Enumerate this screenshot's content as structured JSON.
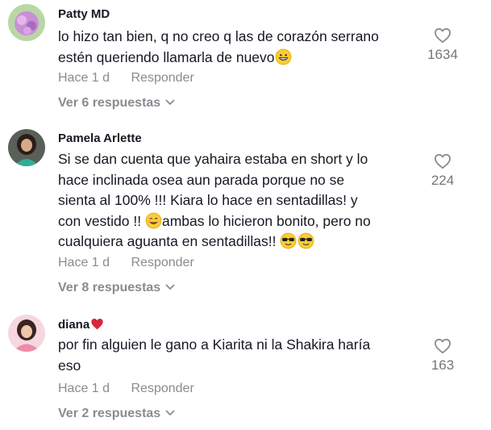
{
  "comments": [
    {
      "username": "Patty MD",
      "text_lines": [
        "lo hizo tan bien, q no creo q las de corazón serrano",
        "estén queriendo llamarla de nuevo"
      ],
      "time": "Hace 1 d",
      "reply_label": "Responder",
      "view_replies": "Ver 6 respuestas",
      "likes": "1634",
      "avatar_color": "#c9a0d8"
    },
    {
      "username": "Pamela Arlette",
      "text_lines": [
        "Si se dan cuenta que yahaira estaba en short y lo",
        "hace inclinada osea aun parada porque no se",
        "sienta al 100% !!! Kiara lo hace en sentadillas! y",
        "con vestido !! ",
        "ambas lo hicieron bonito, pero no",
        "cualquiera aguanta en sentadillas!! "
      ],
      "time": "Hace 1 d",
      "reply_label": "Responder",
      "view_replies": "Ver 8 respuestas",
      "likes": "224",
      "avatar_color": "#3a3a3a"
    },
    {
      "username": "diana",
      "text_lines": [
        "por fin alguien le gano a Kiarita ni la Shakira haría",
        "eso"
      ],
      "time": "Hace 1 d",
      "reply_label": "Responder",
      "view_replies": "Ver 2 respuestas",
      "likes": "163",
      "avatar_color": "#f2b6c6"
    }
  ],
  "colors": {
    "text": "#161823",
    "muted": "#8a8b91",
    "like_count": "#757575",
    "heart_badge": "#d7263d"
  },
  "icons": [
    "heart-outline-icon",
    "chevron-down-icon",
    "grinning-emoji",
    "smiling-emoji",
    "sunglasses-emoji",
    "red-heart-emoji"
  ]
}
